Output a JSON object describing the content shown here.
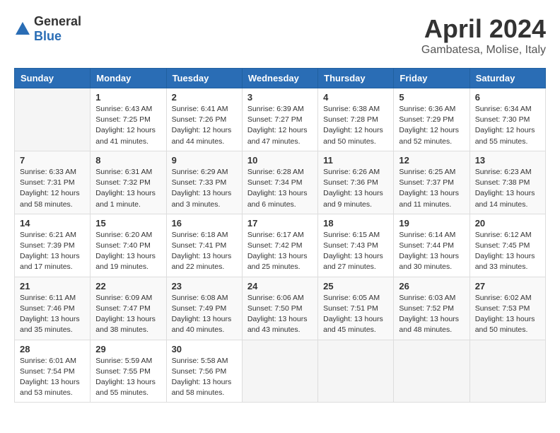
{
  "header": {
    "logo": {
      "general": "General",
      "blue": "Blue"
    },
    "title": "April 2024",
    "location": "Gambatesa, Molise, Italy"
  },
  "calendar": {
    "headers": [
      "Sunday",
      "Monday",
      "Tuesday",
      "Wednesday",
      "Thursday",
      "Friday",
      "Saturday"
    ],
    "weeks": [
      [
        {
          "day": "",
          "info": ""
        },
        {
          "day": "1",
          "info": "Sunrise: 6:43 AM\nSunset: 7:25 PM\nDaylight: 12 hours\nand 41 minutes."
        },
        {
          "day": "2",
          "info": "Sunrise: 6:41 AM\nSunset: 7:26 PM\nDaylight: 12 hours\nand 44 minutes."
        },
        {
          "day": "3",
          "info": "Sunrise: 6:39 AM\nSunset: 7:27 PM\nDaylight: 12 hours\nand 47 minutes."
        },
        {
          "day": "4",
          "info": "Sunrise: 6:38 AM\nSunset: 7:28 PM\nDaylight: 12 hours\nand 50 minutes."
        },
        {
          "day": "5",
          "info": "Sunrise: 6:36 AM\nSunset: 7:29 PM\nDaylight: 12 hours\nand 52 minutes."
        },
        {
          "day": "6",
          "info": "Sunrise: 6:34 AM\nSunset: 7:30 PM\nDaylight: 12 hours\nand 55 minutes."
        }
      ],
      [
        {
          "day": "7",
          "info": "Sunrise: 6:33 AM\nSunset: 7:31 PM\nDaylight: 12 hours\nand 58 minutes."
        },
        {
          "day": "8",
          "info": "Sunrise: 6:31 AM\nSunset: 7:32 PM\nDaylight: 13 hours\nand 1 minute."
        },
        {
          "day": "9",
          "info": "Sunrise: 6:29 AM\nSunset: 7:33 PM\nDaylight: 13 hours\nand 3 minutes."
        },
        {
          "day": "10",
          "info": "Sunrise: 6:28 AM\nSunset: 7:34 PM\nDaylight: 13 hours\nand 6 minutes."
        },
        {
          "day": "11",
          "info": "Sunrise: 6:26 AM\nSunset: 7:36 PM\nDaylight: 13 hours\nand 9 minutes."
        },
        {
          "day": "12",
          "info": "Sunrise: 6:25 AM\nSunset: 7:37 PM\nDaylight: 13 hours\nand 11 minutes."
        },
        {
          "day": "13",
          "info": "Sunrise: 6:23 AM\nSunset: 7:38 PM\nDaylight: 13 hours\nand 14 minutes."
        }
      ],
      [
        {
          "day": "14",
          "info": "Sunrise: 6:21 AM\nSunset: 7:39 PM\nDaylight: 13 hours\nand 17 minutes."
        },
        {
          "day": "15",
          "info": "Sunrise: 6:20 AM\nSunset: 7:40 PM\nDaylight: 13 hours\nand 19 minutes."
        },
        {
          "day": "16",
          "info": "Sunrise: 6:18 AM\nSunset: 7:41 PM\nDaylight: 13 hours\nand 22 minutes."
        },
        {
          "day": "17",
          "info": "Sunrise: 6:17 AM\nSunset: 7:42 PM\nDaylight: 13 hours\nand 25 minutes."
        },
        {
          "day": "18",
          "info": "Sunrise: 6:15 AM\nSunset: 7:43 PM\nDaylight: 13 hours\nand 27 minutes."
        },
        {
          "day": "19",
          "info": "Sunrise: 6:14 AM\nSunset: 7:44 PM\nDaylight: 13 hours\nand 30 minutes."
        },
        {
          "day": "20",
          "info": "Sunrise: 6:12 AM\nSunset: 7:45 PM\nDaylight: 13 hours\nand 33 minutes."
        }
      ],
      [
        {
          "day": "21",
          "info": "Sunrise: 6:11 AM\nSunset: 7:46 PM\nDaylight: 13 hours\nand 35 minutes."
        },
        {
          "day": "22",
          "info": "Sunrise: 6:09 AM\nSunset: 7:47 PM\nDaylight: 13 hours\nand 38 minutes."
        },
        {
          "day": "23",
          "info": "Sunrise: 6:08 AM\nSunset: 7:49 PM\nDaylight: 13 hours\nand 40 minutes."
        },
        {
          "day": "24",
          "info": "Sunrise: 6:06 AM\nSunset: 7:50 PM\nDaylight: 13 hours\nand 43 minutes."
        },
        {
          "day": "25",
          "info": "Sunrise: 6:05 AM\nSunset: 7:51 PM\nDaylight: 13 hours\nand 45 minutes."
        },
        {
          "day": "26",
          "info": "Sunrise: 6:03 AM\nSunset: 7:52 PM\nDaylight: 13 hours\nand 48 minutes."
        },
        {
          "day": "27",
          "info": "Sunrise: 6:02 AM\nSunset: 7:53 PM\nDaylight: 13 hours\nand 50 minutes."
        }
      ],
      [
        {
          "day": "28",
          "info": "Sunrise: 6:01 AM\nSunset: 7:54 PM\nDaylight: 13 hours\nand 53 minutes."
        },
        {
          "day": "29",
          "info": "Sunrise: 5:59 AM\nSunset: 7:55 PM\nDaylight: 13 hours\nand 55 minutes."
        },
        {
          "day": "30",
          "info": "Sunrise: 5:58 AM\nSunset: 7:56 PM\nDaylight: 13 hours\nand 58 minutes."
        },
        {
          "day": "",
          "info": ""
        },
        {
          "day": "",
          "info": ""
        },
        {
          "day": "",
          "info": ""
        },
        {
          "day": "",
          "info": ""
        }
      ]
    ]
  }
}
